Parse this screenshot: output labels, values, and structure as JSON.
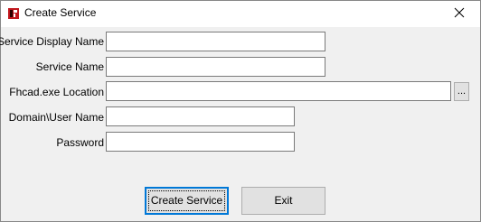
{
  "window": {
    "title": "Create Service",
    "icon": "app-icon",
    "close_icon": "close-icon"
  },
  "form": {
    "display_name": {
      "label": "Service Display Name",
      "value": ""
    },
    "service_name": {
      "label": "Service Name",
      "value": ""
    },
    "location": {
      "label": "Fhcad.exe Location",
      "value": "",
      "browse_label": "..."
    },
    "domain_user": {
      "label": "Domain\\User Name",
      "value": ""
    },
    "password": {
      "label": "Password",
      "value": ""
    }
  },
  "buttons": {
    "create_label": "Create Service",
    "exit_label": "Exit"
  },
  "colors": {
    "window_bg": "#f0f0f0",
    "focus_border": "#0078d7",
    "app_icon_red": "#c0161c"
  }
}
